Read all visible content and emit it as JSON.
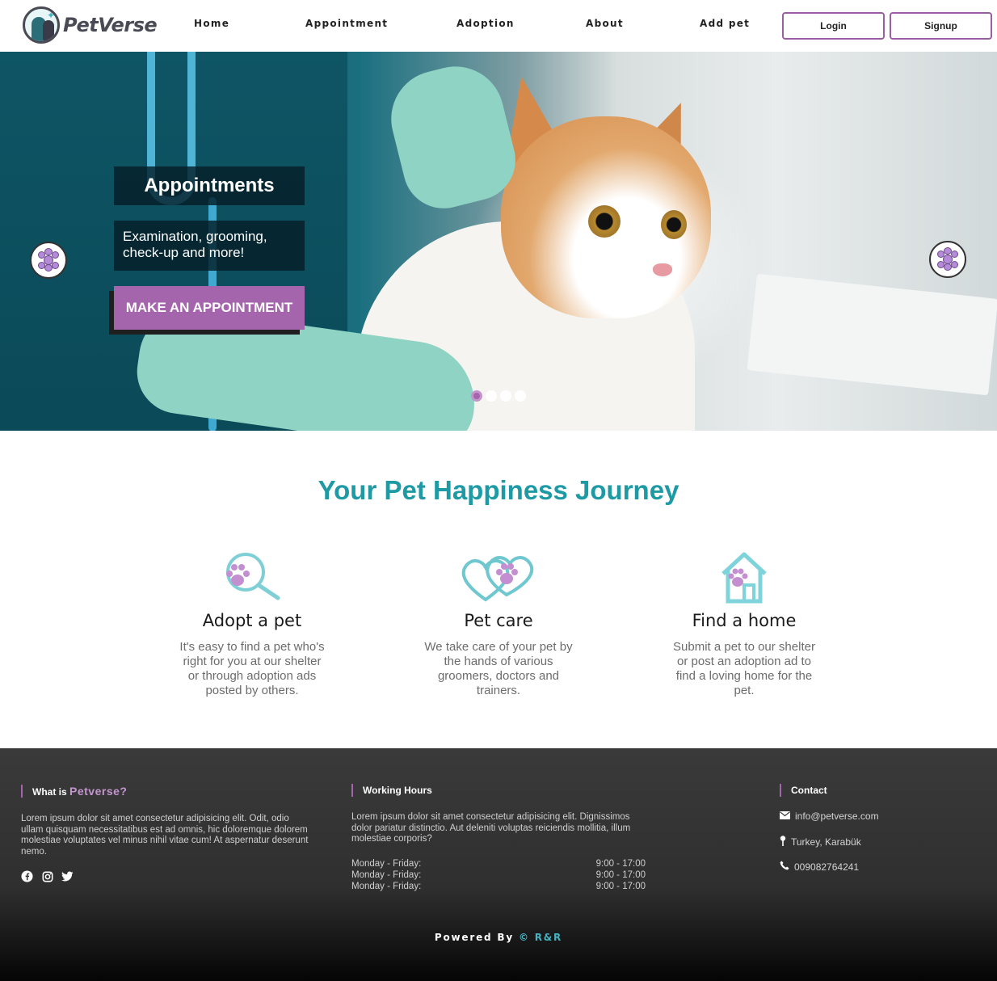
{
  "brand": {
    "name": "PetVerse"
  },
  "nav": {
    "links": [
      "Home",
      "Appointment",
      "Adoption",
      "About",
      "Add pet"
    ],
    "login": "Login",
    "signup": "Signup"
  },
  "hero": {
    "title": "Appointments",
    "subtitle": "Examination, grooming, check-up and more!",
    "cta": "MAKE AN APPOINTMENT",
    "slides": 4,
    "active_slide": 1
  },
  "journey": {
    "title": "Your Pet Happiness Journey",
    "features": [
      {
        "icon": "search-paw-icon",
        "title": "Adopt a pet",
        "text": "It's easy to find a pet who's right for you at our shelter or through adoption ads posted by others."
      },
      {
        "icon": "heart-paw-icon",
        "title": "Pet care",
        "text": "We take care of your pet by the hands of various groomers, doctors and trainers."
      },
      {
        "icon": "house-paw-icon",
        "title": "Find a home",
        "text": "Submit a pet to our shelter or post an adoption ad to find a loving home for the pet."
      }
    ]
  },
  "footer": {
    "about": {
      "heading_prefix": "What is",
      "heading_brand": "Petverse",
      "heading_suffix": "?",
      "text": "Lorem ipsum dolor sit amet consectetur adipisicing elit. Odit, odio ullam quisquam necessitatibus est ad omnis, hic doloremque dolorem molestiae voluptates vel minus nihil vitae cum! At aspernatur deserunt nemo."
    },
    "hours": {
      "heading": "Working Hours",
      "text": "Lorem ipsum dolor sit amet consectetur adipisicing elit. Dignissimos dolor pariatur distinctio. Aut deleniti voluptas reiciendis mollitia, illum molestiae corporis?",
      "rows": [
        {
          "day": "Monday - Friday:",
          "time": "9:00 - 17:00"
        },
        {
          "day": "Monday - Friday:",
          "time": "9:00 - 17:00"
        },
        {
          "day": "Monday - Friday:",
          "time": "9:00 - 17:00"
        }
      ]
    },
    "contact": {
      "heading": "Contact",
      "email": "info@petverse.com",
      "location": "Turkey, Karabük",
      "phone": "009082764241"
    },
    "powered_prefix": "Powered By",
    "powered_brand": "© R&R"
  },
  "colors": {
    "accent": "#a465ad",
    "teal": "#1e9aa5",
    "footer": "#333333"
  }
}
